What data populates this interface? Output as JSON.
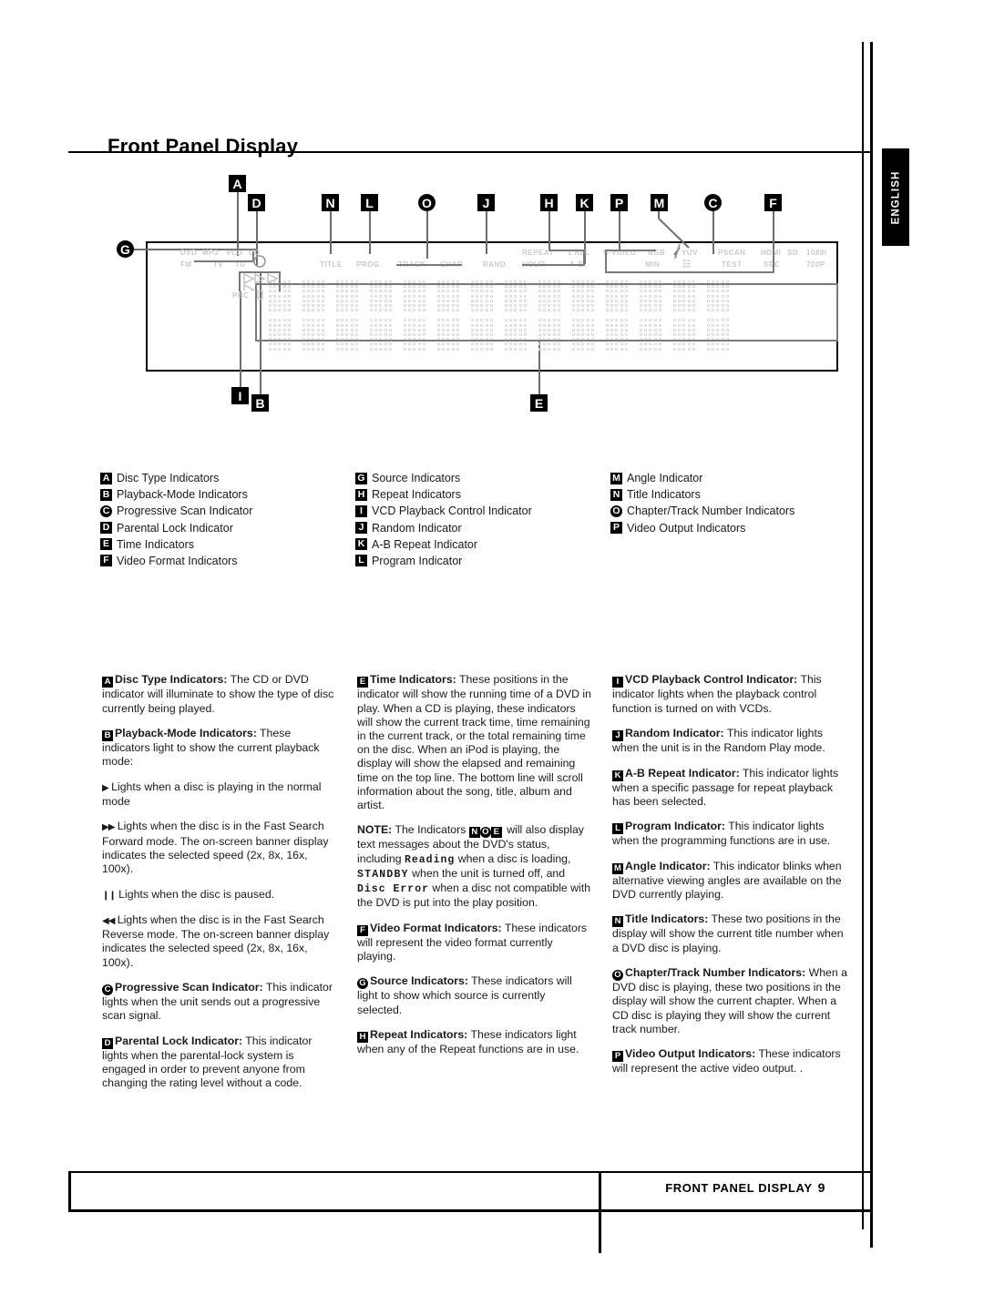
{
  "page": {
    "title": "Front Panel Display",
    "side_tab": "ENGLISH",
    "footer_label": "FRONT PANEL DISPLAY",
    "footer_page": "9"
  },
  "diagram": {
    "markers_top": [
      {
        "id": "A",
        "shape": "square"
      },
      {
        "id": "D",
        "shape": "square"
      },
      {
        "id": "N",
        "shape": "square"
      },
      {
        "id": "L",
        "shape": "square"
      },
      {
        "id": "O",
        "shape": "round"
      },
      {
        "id": "J",
        "shape": "square"
      },
      {
        "id": "H",
        "shape": "square"
      },
      {
        "id": "K",
        "shape": "square"
      },
      {
        "id": "P",
        "shape": "square"
      },
      {
        "id": "M",
        "shape": "square"
      },
      {
        "id": "C",
        "shape": "round"
      },
      {
        "id": "F",
        "shape": "square"
      }
    ],
    "markers_left": [
      {
        "id": "G",
        "shape": "round"
      }
    ],
    "markers_bottom": [
      {
        "id": "I",
        "shape": "square"
      },
      {
        "id": "B",
        "shape": "square"
      },
      {
        "id": "E",
        "shape": "square"
      }
    ],
    "lcd_labels_row1": [
      "DVD",
      "MP3",
      "VCD",
      "CD",
      "TITLE",
      "PROG.",
      "TRACK",
      "CHAP.",
      "RAND.",
      "REPEAT",
      "1 ALL",
      "S-VIDEO",
      "RGB",
      "YUV",
      "PSCAN",
      "HDMI",
      "SD",
      "1080i"
    ],
    "lcd_labels_row2": [
      "FM",
      "TV",
      "TU",
      "HOUR",
      "A-B",
      "MIN",
      "TEST",
      "SEC",
      "720P"
    ],
    "lcd_labels_row3": [
      "PBC"
    ]
  },
  "legend": {
    "col1": [
      {
        "id": "A",
        "shape": "square",
        "label": "Disc Type Indicators"
      },
      {
        "id": "B",
        "shape": "square",
        "label": "Playback-Mode Indicators"
      },
      {
        "id": "C",
        "shape": "round",
        "label": "Progressive Scan Indicator"
      },
      {
        "id": "D",
        "shape": "square",
        "label": "Parental Lock Indicator"
      },
      {
        "id": "E",
        "shape": "square",
        "label": "Time Indicators"
      },
      {
        "id": "F",
        "shape": "square",
        "label": "Video Format Indicators"
      }
    ],
    "col2": [
      {
        "id": "G",
        "shape": "round",
        "label": "Source Indicators"
      },
      {
        "id": "H",
        "shape": "square",
        "label": "Repeat Indicators"
      },
      {
        "id": "I",
        "shape": "square",
        "label": "VCD Playback Control Indicator"
      },
      {
        "id": "J",
        "shape": "square",
        "label": "Random Indicator"
      },
      {
        "id": "K",
        "shape": "square",
        "label": "A-B Repeat Indicator"
      },
      {
        "id": "L",
        "shape": "square",
        "label": "Program Indicator"
      }
    ],
    "col3": [
      {
        "id": "M",
        "shape": "square",
        "label": "Angle Indicator"
      },
      {
        "id": "N",
        "shape": "square",
        "label": "Title Indicators"
      },
      {
        "id": "O",
        "shape": "round",
        "label": "Chapter/Track Number Indicators"
      },
      {
        "id": "P",
        "shape": "square",
        "label": "Video Output Indicators"
      }
    ]
  },
  "body": {
    "col1": {
      "p_a_badge": "A",
      "p_a_term": "Disc Type Indicators:",
      "p_a_text": " The CD or DVD indicator will illuminate to show the type of disc currently being played.",
      "p_b_badge": "B",
      "p_b_term": "Playback-Mode Indicators:",
      "p_b_text": " These indicators light to show the current playback mode:",
      "p_play_glyph": "▶",
      "p_play_text": " Lights when a disc is playing in the normal mode",
      "p_ff_glyph": "▶▶",
      "p_ff_text": " Lights when the disc is in the Fast Search Forward mode. The on-screen banner display indicates the selected speed (2x, 8x, 16x, 100x).",
      "p_pause_glyph": "❙❙",
      "p_pause_text": " Lights when the disc is paused.",
      "p_rew_glyph": "◀◀",
      "p_rew_text": " Lights when the disc is in the Fast Search Reverse mode. The on-screen banner display indicates the selected speed (2x, 8x, 16x, 100x).",
      "p_c_badge": "C",
      "p_c_term": "Progressive Scan Indicator:",
      "p_c_text": " This indicator lights when the unit sends out a progressive scan signal.",
      "p_d_badge": "D",
      "p_d_term": "Parental Lock Indicator:",
      "p_d_text": " This indicator lights when the parental-lock system is engaged in order to prevent anyone from changing the rating level without a code."
    },
    "col2": {
      "p_e_badge": "E",
      "p_e_term": "Time Indicators:",
      "p_e_text": " These positions in the indicator will show the running time of a DVD in play. When a CD is playing, these indicators will show the current track time, time remaining in the current track, or the total remaining time on the disc. When an iPod is playing, the display will show the elapsed and remaining time on the top line. The bottom line will scroll information about the song, title, album and artist.",
      "p_note_term": "NOTE:",
      "p_note_pre": " The Indicators ",
      "p_note_badges": [
        "N",
        "O",
        "E"
      ],
      "p_note_mid": " will also display text messages about the DVD's status, including ",
      "p_note_reading": "Reading",
      "p_note_after_reading": " when a disc is loading, ",
      "p_note_standby": "STANDBY",
      "p_note_after_standby": " when the unit is turned off, and ",
      "p_note_discerror": "Disc Error",
      "p_note_end": " when a disc not compatible with the DVD is put into the play position.",
      "p_f_badge": "F",
      "p_f_term": "Video Format Indicators:",
      "p_f_text": " These indicators will represent the video format currently playing.",
      "p_g_badge": "G",
      "p_g_term": "Source Indicators:",
      "p_g_text": " These indicators will light to show which source is currently selected.",
      "p_h_badge": "H",
      "p_h_term": "Repeat Indicators:",
      "p_h_text": " These indicators light when any of the Repeat functions are in use."
    },
    "col3": {
      "p_i_badge": "I",
      "p_i_term": "VCD Playback Control Indicator:",
      "p_i_text": " This indicator lights when the playback control function is turned on with VCDs.",
      "p_j_badge": "J",
      "p_j_term": "Random Indicator:",
      "p_j_text": " This indicator lights when the unit is in the Random Play mode.",
      "p_k_badge": "K",
      "p_k_term": "A-B Repeat Indicator:",
      "p_k_text": " This indicator lights when a specific passage for repeat playback has been selected.",
      "p_l_badge": "L",
      "p_l_term": "Program Indicator:",
      "p_l_text": " This indicator lights when the programming functions are in use.",
      "p_m_badge": "M",
      "p_m_term": "Angle Indicator:",
      "p_m_text": " This indicator blinks when alternative viewing angles are available on the DVD currently playing.",
      "p_n_badge": "N",
      "p_n_term": "Title Indicators:",
      "p_n_text": " These two positions in the display will show the current title number when a DVD disc is playing.",
      "p_o_badge": "O",
      "p_o_term": "Chapter/Track Number Indicators:",
      "p_o_text": " When a DVD disc is playing, these two positions in the display will show the current chapter. When a CD disc is playing they will show the current track number.",
      "p_p_badge": "P",
      "p_p_term": "Video Output Indicators:",
      "p_p_text": " These indicators will represent the active video output. ."
    }
  }
}
